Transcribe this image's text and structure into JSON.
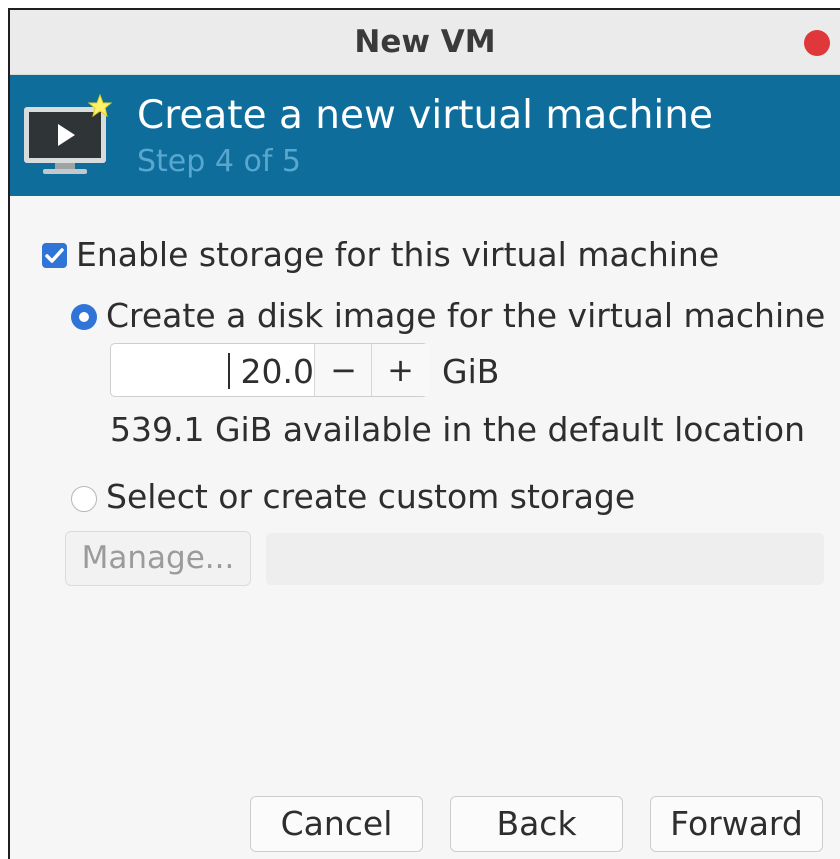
{
  "window": {
    "title": "New VM"
  },
  "banner": {
    "title": "Create a new virtual machine",
    "step": "Step 4 of 5",
    "icon": "vm-monitor-icon"
  },
  "storage": {
    "enable_label": "Enable storage for this virtual machine",
    "enable_checked": true,
    "create_disk_label": "Create a disk image for the virtual machine",
    "create_disk_selected": true,
    "size_value": "20.0",
    "size_unit": "GiB",
    "decrement_label": "−",
    "increment_label": "+",
    "available_text": "539.1 GiB available in the default location",
    "custom_label": "Select or create custom storage",
    "custom_selected": false,
    "manage_label": "Manage...",
    "custom_path": ""
  },
  "footer": {
    "cancel_label": "Cancel",
    "back_label": "Back",
    "forward_label": "Forward"
  },
  "colors": {
    "banner": "#0e6d9b",
    "accent": "#2f74d6",
    "close": "#e0373a"
  }
}
